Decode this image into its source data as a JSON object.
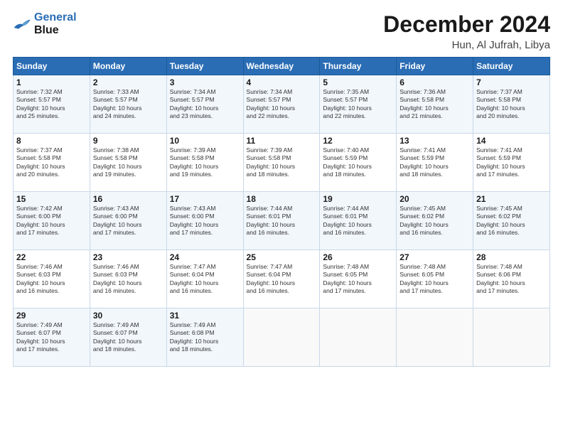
{
  "header": {
    "logo_line1": "General",
    "logo_line2": "Blue",
    "month": "December 2024",
    "location": "Hun, Al Jufrah, Libya"
  },
  "weekdays": [
    "Sunday",
    "Monday",
    "Tuesday",
    "Wednesday",
    "Thursday",
    "Friday",
    "Saturday"
  ],
  "weeks": [
    [
      {
        "day": "1",
        "info": "Sunrise: 7:32 AM\nSunset: 5:57 PM\nDaylight: 10 hours\nand 25 minutes."
      },
      {
        "day": "2",
        "info": "Sunrise: 7:33 AM\nSunset: 5:57 PM\nDaylight: 10 hours\nand 24 minutes."
      },
      {
        "day": "3",
        "info": "Sunrise: 7:34 AM\nSunset: 5:57 PM\nDaylight: 10 hours\nand 23 minutes."
      },
      {
        "day": "4",
        "info": "Sunrise: 7:34 AM\nSunset: 5:57 PM\nDaylight: 10 hours\nand 22 minutes."
      },
      {
        "day": "5",
        "info": "Sunrise: 7:35 AM\nSunset: 5:57 PM\nDaylight: 10 hours\nand 22 minutes."
      },
      {
        "day": "6",
        "info": "Sunrise: 7:36 AM\nSunset: 5:58 PM\nDaylight: 10 hours\nand 21 minutes."
      },
      {
        "day": "7",
        "info": "Sunrise: 7:37 AM\nSunset: 5:58 PM\nDaylight: 10 hours\nand 20 minutes."
      }
    ],
    [
      {
        "day": "8",
        "info": "Sunrise: 7:37 AM\nSunset: 5:58 PM\nDaylight: 10 hours\nand 20 minutes."
      },
      {
        "day": "9",
        "info": "Sunrise: 7:38 AM\nSunset: 5:58 PM\nDaylight: 10 hours\nand 19 minutes."
      },
      {
        "day": "10",
        "info": "Sunrise: 7:39 AM\nSunset: 5:58 PM\nDaylight: 10 hours\nand 19 minutes."
      },
      {
        "day": "11",
        "info": "Sunrise: 7:39 AM\nSunset: 5:58 PM\nDaylight: 10 hours\nand 18 minutes."
      },
      {
        "day": "12",
        "info": "Sunrise: 7:40 AM\nSunset: 5:59 PM\nDaylight: 10 hours\nand 18 minutes."
      },
      {
        "day": "13",
        "info": "Sunrise: 7:41 AM\nSunset: 5:59 PM\nDaylight: 10 hours\nand 18 minutes."
      },
      {
        "day": "14",
        "info": "Sunrise: 7:41 AM\nSunset: 5:59 PM\nDaylight: 10 hours\nand 17 minutes."
      }
    ],
    [
      {
        "day": "15",
        "info": "Sunrise: 7:42 AM\nSunset: 6:00 PM\nDaylight: 10 hours\nand 17 minutes."
      },
      {
        "day": "16",
        "info": "Sunrise: 7:43 AM\nSunset: 6:00 PM\nDaylight: 10 hours\nand 17 minutes."
      },
      {
        "day": "17",
        "info": "Sunrise: 7:43 AM\nSunset: 6:00 PM\nDaylight: 10 hours\nand 17 minutes."
      },
      {
        "day": "18",
        "info": "Sunrise: 7:44 AM\nSunset: 6:01 PM\nDaylight: 10 hours\nand 16 minutes."
      },
      {
        "day": "19",
        "info": "Sunrise: 7:44 AM\nSunset: 6:01 PM\nDaylight: 10 hours\nand 16 minutes."
      },
      {
        "day": "20",
        "info": "Sunrise: 7:45 AM\nSunset: 6:02 PM\nDaylight: 10 hours\nand 16 minutes."
      },
      {
        "day": "21",
        "info": "Sunrise: 7:45 AM\nSunset: 6:02 PM\nDaylight: 10 hours\nand 16 minutes."
      }
    ],
    [
      {
        "day": "22",
        "info": "Sunrise: 7:46 AM\nSunset: 6:03 PM\nDaylight: 10 hours\nand 16 minutes."
      },
      {
        "day": "23",
        "info": "Sunrise: 7:46 AM\nSunset: 6:03 PM\nDaylight: 10 hours\nand 16 minutes."
      },
      {
        "day": "24",
        "info": "Sunrise: 7:47 AM\nSunset: 6:04 PM\nDaylight: 10 hours\nand 16 minutes."
      },
      {
        "day": "25",
        "info": "Sunrise: 7:47 AM\nSunset: 6:04 PM\nDaylight: 10 hours\nand 16 minutes."
      },
      {
        "day": "26",
        "info": "Sunrise: 7:48 AM\nSunset: 6:05 PM\nDaylight: 10 hours\nand 17 minutes."
      },
      {
        "day": "27",
        "info": "Sunrise: 7:48 AM\nSunset: 6:05 PM\nDaylight: 10 hours\nand 17 minutes."
      },
      {
        "day": "28",
        "info": "Sunrise: 7:48 AM\nSunset: 6:06 PM\nDaylight: 10 hours\nand 17 minutes."
      }
    ],
    [
      {
        "day": "29",
        "info": "Sunrise: 7:49 AM\nSunset: 6:07 PM\nDaylight: 10 hours\nand 17 minutes."
      },
      {
        "day": "30",
        "info": "Sunrise: 7:49 AM\nSunset: 6:07 PM\nDaylight: 10 hours\nand 18 minutes."
      },
      {
        "day": "31",
        "info": "Sunrise: 7:49 AM\nSunset: 6:08 PM\nDaylight: 10 hours\nand 18 minutes."
      },
      null,
      null,
      null,
      null
    ]
  ]
}
